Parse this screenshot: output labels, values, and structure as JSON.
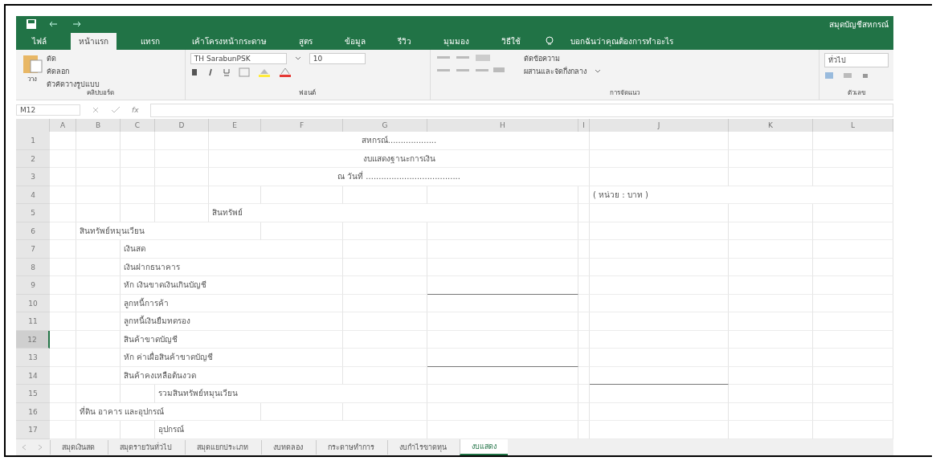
{
  "window": {
    "title": "สมุดบัญชีสหกรณ์"
  },
  "ribbon": {
    "tabs": [
      {
        "label": "ไฟล์",
        "selected": false
      },
      {
        "label": "หน้าแรก",
        "selected": true
      },
      {
        "label": "แทรก",
        "selected": false
      },
      {
        "label": "เค้าโครงหน้ากระดาษ",
        "selected": false
      },
      {
        "label": "สูตร",
        "selected": false
      },
      {
        "label": "ข้อมูล",
        "selected": false
      },
      {
        "label": "รีวิว",
        "selected": false
      },
      {
        "label": "มุมมอง",
        "selected": false
      },
      {
        "label": "วิธีใช้",
        "selected": false
      }
    ],
    "tell_me": "บอกฉันว่าคุณต้องการทำอะไร",
    "clipboard": {
      "paste": "วาง",
      "items": [
        "ตัด",
        "คัดลอก",
        "ตัวคัดวางรูปแบบ"
      ],
      "label": "คลิปบอร์ด"
    },
    "font": {
      "name": "TH SarabunPSK",
      "size": "10",
      "label": "ฟอนต์"
    },
    "alignment": {
      "wrap": "ตัดข้อความ",
      "merge": "ผสานและจัดกึ่งกลาง",
      "label": "การจัดแนว"
    },
    "number": {
      "format": "ทั่วไป",
      "label": "ตัวเลข"
    }
  },
  "formula_bar": {
    "name_box": "M12",
    "fx": "fx"
  },
  "sheet": {
    "columns": [
      "A",
      "B",
      "C",
      "D",
      "E",
      "F",
      "G",
      "H",
      "I",
      "J",
      "K",
      "L"
    ],
    "rows": [
      {
        "header": "1",
        "selected": false,
        "kind": "title",
        "cells": [
          {
            "text": ""
          },
          {
            "text": ""
          },
          {
            "text": ""
          },
          {
            "text": ""
          },
          {
            "text": "สหกรณ์..................."
          }
        ]
      },
      {
        "header": "2",
        "selected": false,
        "kind": "title",
        "cells": [
          {
            "text": ""
          },
          {
            "text": ""
          },
          {
            "text": ""
          },
          {
            "text": ""
          },
          {
            "text": "งบแสดงฐานะการเงิน"
          }
        ]
      },
      {
        "header": "3",
        "selected": false,
        "kind": "title",
        "cells": [
          {
            "text": ""
          },
          {
            "text": ""
          },
          {
            "text": ""
          },
          {
            "text": ""
          },
          {
            "text": "ณ วันที่ ....................................."
          }
        ]
      },
      {
        "header": "4",
        "selected": false,
        "kind": "plain",
        "cells": [
          {
            "text": ""
          },
          {
            "text": ""
          },
          {
            "text": ""
          },
          {
            "text": ""
          },
          {
            "text": ""
          },
          {
            "text": ""
          },
          {
            "text": ""
          },
          {
            "text": ""
          },
          {
            "text": ""
          },
          {
            "text": "( หน่วย : บาท )"
          }
        ]
      },
      {
        "header": "5",
        "selected": false,
        "kind": "plain",
        "cells": [
          {
            "text": ""
          },
          {
            "text": ""
          },
          {
            "text": ""
          },
          {
            "text": ""
          },
          {
            "text": "สินทรัพย์"
          }
        ]
      },
      {
        "header": "6",
        "selected": false,
        "kind": "plain",
        "cells": [
          {
            "text": ""
          },
          {
            "text": "สินทรัพย์หมุนเวียน"
          }
        ]
      },
      {
        "header": "7",
        "selected": false,
        "kind": "plain",
        "cells": [
          {
            "text": ""
          },
          {
            "text": ""
          },
          {
            "text": "เงินสด"
          }
        ]
      },
      {
        "header": "8",
        "selected": false,
        "kind": "plain",
        "cells": [
          {
            "text": ""
          },
          {
            "text": ""
          },
          {
            "text": "เงินฝากธนาคาร"
          }
        ]
      },
      {
        "header": "9",
        "selected": false,
        "kind": "plain",
        "cells": [
          {
            "text": ""
          },
          {
            "text": ""
          },
          {
            "text": "หัก เงินขาดเงินเกินบัญชี"
          },
          {
            "text": ""
          },
          {
            "text": ""
          },
          {
            "text": ""
          },
          {
            "text": ""
          },
          {
            "text": "",
            "bottom_border": true
          }
        ]
      },
      {
        "header": "10",
        "selected": false,
        "kind": "plain",
        "cells": [
          {
            "text": ""
          },
          {
            "text": ""
          },
          {
            "text": "ลูกหนี้การค้า"
          }
        ]
      },
      {
        "header": "11",
        "selected": false,
        "kind": "plain",
        "cells": [
          {
            "text": ""
          },
          {
            "text": ""
          },
          {
            "text": "ลูกหนี้เงินยืมทดรอง"
          }
        ]
      },
      {
        "header": "12",
        "selected": true,
        "kind": "plain",
        "cells": [
          {
            "text": ""
          },
          {
            "text": ""
          },
          {
            "text": "สินค้าขาดบัญชี"
          }
        ]
      },
      {
        "header": "13",
        "selected": false,
        "kind": "plain",
        "cells": [
          {
            "text": ""
          },
          {
            "text": ""
          },
          {
            "text": "หัก ค่าเผื่อสินค้าขาดบัญชี"
          },
          {
            "text": ""
          },
          {
            "text": ""
          },
          {
            "text": ""
          },
          {
            "text": ""
          },
          {
            "text": "",
            "bottom_border": true
          }
        ]
      },
      {
        "header": "14",
        "selected": false,
        "kind": "plain",
        "cells": [
          {
            "text": ""
          },
          {
            "text": ""
          },
          {
            "text": "สินค้าคงเหลือต้นงวด"
          },
          {
            "text": ""
          },
          {
            "text": ""
          },
          {
            "text": ""
          },
          {
            "text": ""
          },
          {
            "text": ""
          },
          {
            "text": ""
          },
          {
            "text": "",
            "bottom_border": true
          }
        ]
      },
      {
        "header": "15",
        "selected": false,
        "kind": "plain",
        "cells": [
          {
            "text": ""
          },
          {
            "text": ""
          },
          {
            "text": ""
          },
          {
            "text": "รวมสินทรัพย์หมุนเวียน"
          }
        ]
      },
      {
        "header": "16",
        "selected": false,
        "kind": "plain",
        "cells": [
          {
            "text": ""
          },
          {
            "text": "ที่ดิน อาคาร และอุปกรณ์"
          }
        ]
      },
      {
        "header": "17",
        "selected": false,
        "kind": "plain",
        "cells": [
          {
            "text": ""
          },
          {
            "text": ""
          },
          {
            "text": ""
          },
          {
            "text": "อุปกรณ์"
          }
        ]
      }
    ]
  },
  "sheet_tabs": [
    {
      "label": "สมุดเงินสด",
      "selected": false
    },
    {
      "label": "สมุดรายวันทั่วไป",
      "selected": false
    },
    {
      "label": "สมุดแยกประเภท",
      "selected": false
    },
    {
      "label": "งบทดลอง",
      "selected": false
    },
    {
      "label": "กระดาษทำการ",
      "selected": false
    },
    {
      "label": "งบกำไรขาดทุน",
      "selected": false
    },
    {
      "label": "งบแสดง",
      "selected": true
    }
  ]
}
